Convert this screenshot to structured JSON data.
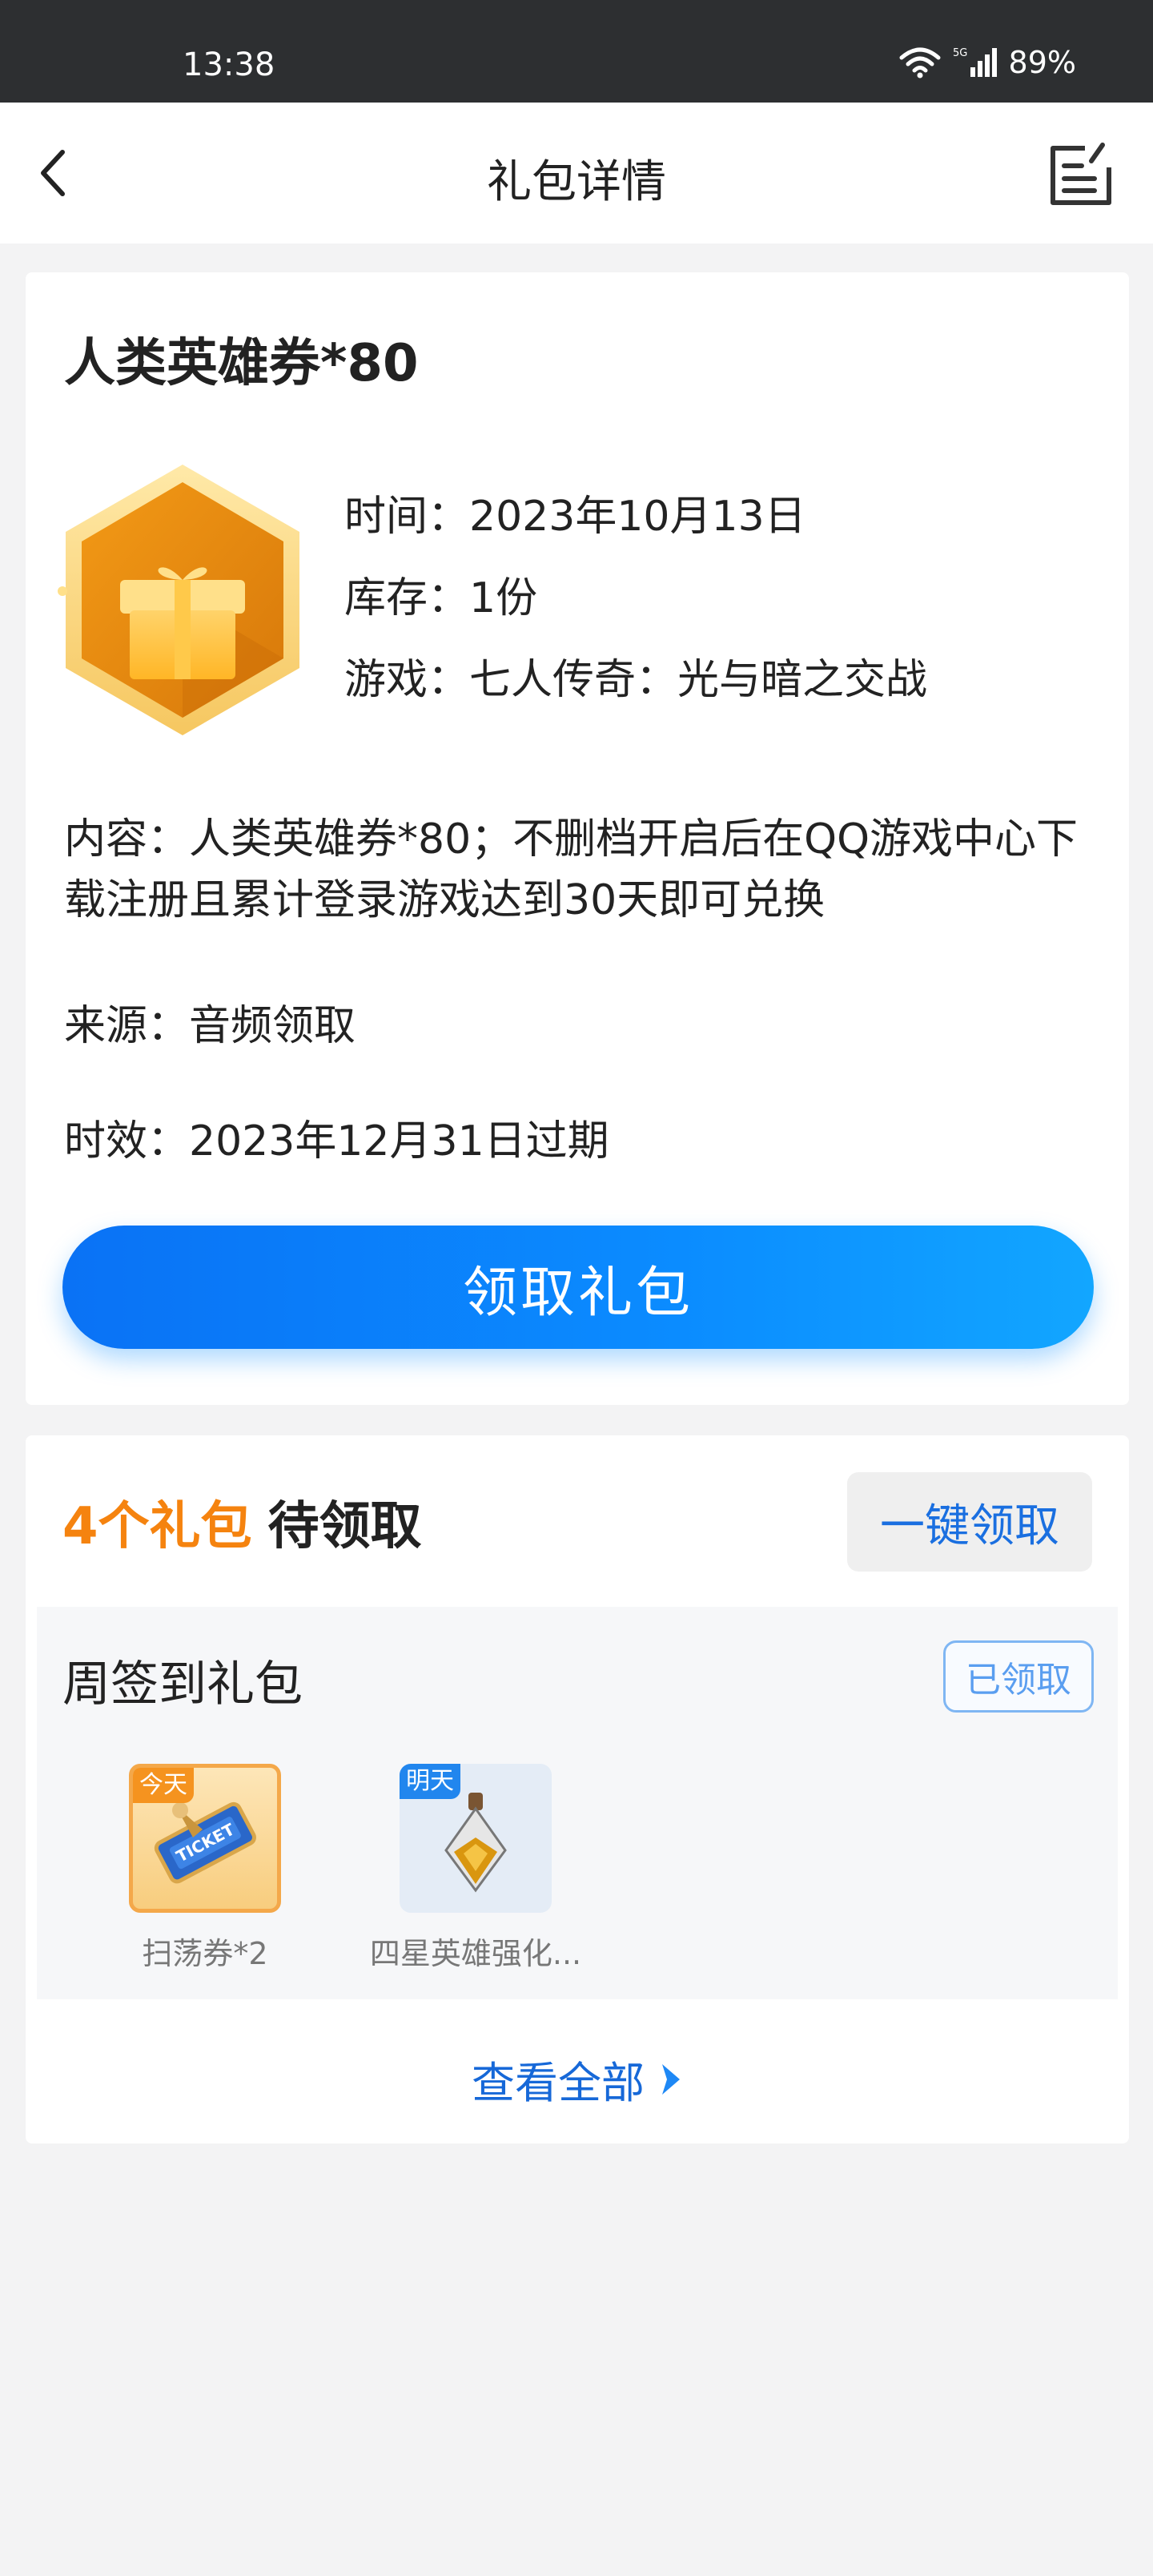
{
  "status_bar": {
    "time": "13:38",
    "network": "5G",
    "battery": "89%"
  },
  "nav": {
    "title": "礼包详情",
    "back_icon": "chevron-left-icon",
    "edit_icon": "edit-note-icon"
  },
  "gift": {
    "title": "人类英雄券*80",
    "icon": "gift-hexagon-icon",
    "time_line": "时间：2023年10月13日",
    "stock_line": "库存：1份",
    "game_line": "游戏：七人传奇：光与暗之交战",
    "content": "内容：人类英雄券*80；不删档开启后在QQ游戏中心下载注册且累计登录游戏达到30天即可兑换",
    "source": "来源：音频领取",
    "expiry": "时效：2023年12月31日过期",
    "claim_label": "领取礼包"
  },
  "pending": {
    "count_label": "4个礼包",
    "suffix": "待领取",
    "one_key_label": "一键领取"
  },
  "weekly": {
    "title": "周签到礼包",
    "status": "已领取",
    "rewards": [
      {
        "tag": "今天",
        "label": "扫荡券*2",
        "icon": "ticket-icon"
      },
      {
        "tag": "明天",
        "label": "四星英雄强化...",
        "icon": "potion-icon"
      }
    ]
  },
  "footer": {
    "view_all": "查看全部"
  },
  "colors": {
    "accent_blue": "#0b8cff",
    "accent_orange": "#f5830f"
  }
}
